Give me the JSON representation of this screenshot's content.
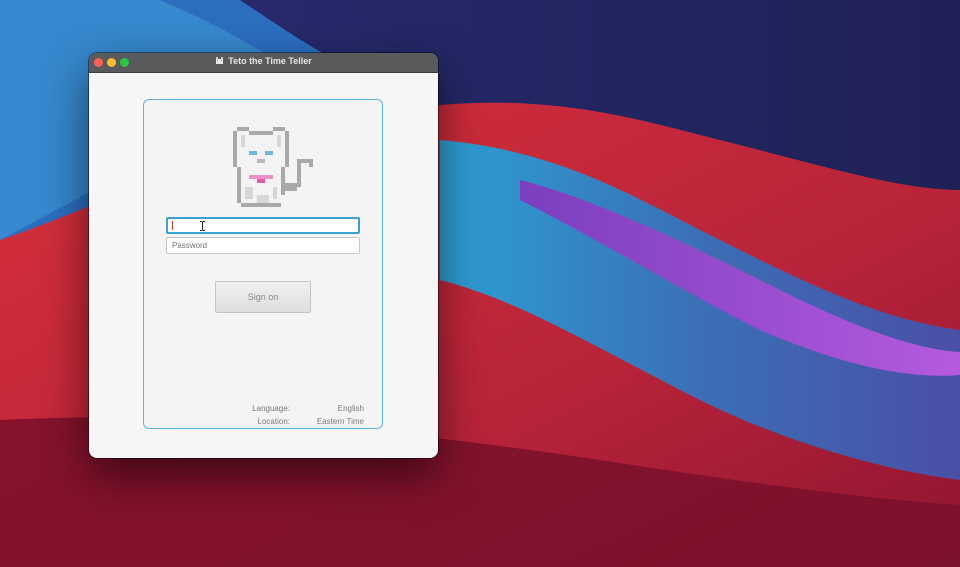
{
  "window": {
    "title": "Teto the Time Teller",
    "app_icon": "cat-icon"
  },
  "login": {
    "username": {
      "value": "",
      "placeholder": ""
    },
    "password": {
      "value": "",
      "placeholder": "Password"
    },
    "sign_on_label": "Sign on"
  },
  "info": {
    "language_label": "Language:",
    "language_value": "English",
    "location_label": "Location:",
    "location_value": "Eastern Time"
  },
  "colors": {
    "panel_border": "#5ab6ea",
    "focus_ring": "#3aa0d8",
    "traffic_close": "#fe5f57",
    "traffic_minimize": "#febc2e",
    "traffic_maximize": "#29c840"
  }
}
